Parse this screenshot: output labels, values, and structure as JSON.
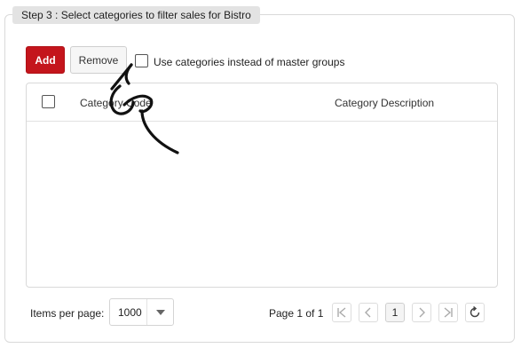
{
  "step": {
    "legend": "Step 3 : Select categories to filter sales for Bistro"
  },
  "toolbar": {
    "add_label": "Add",
    "remove_label": "Remove",
    "use_categories_label": "Use categories instead of master groups",
    "use_categories_checked": false
  },
  "grid": {
    "columns": [
      "Category Code",
      "Category Description"
    ],
    "rows": []
  },
  "pager": {
    "items_per_page_label": "Items per page:",
    "items_per_page_value": "1000",
    "page_info": "Page 1 of 1",
    "current_page": "1"
  },
  "icons": {
    "first": "first-page-icon",
    "prev": "previous-page-icon",
    "next": "next-page-icon",
    "last": "last-page-icon",
    "refresh": "refresh-icon",
    "dropdown": "chevron-down-icon"
  },
  "colors": {
    "add_button": "#c4151c",
    "legend_bg": "#e3e3e3"
  }
}
